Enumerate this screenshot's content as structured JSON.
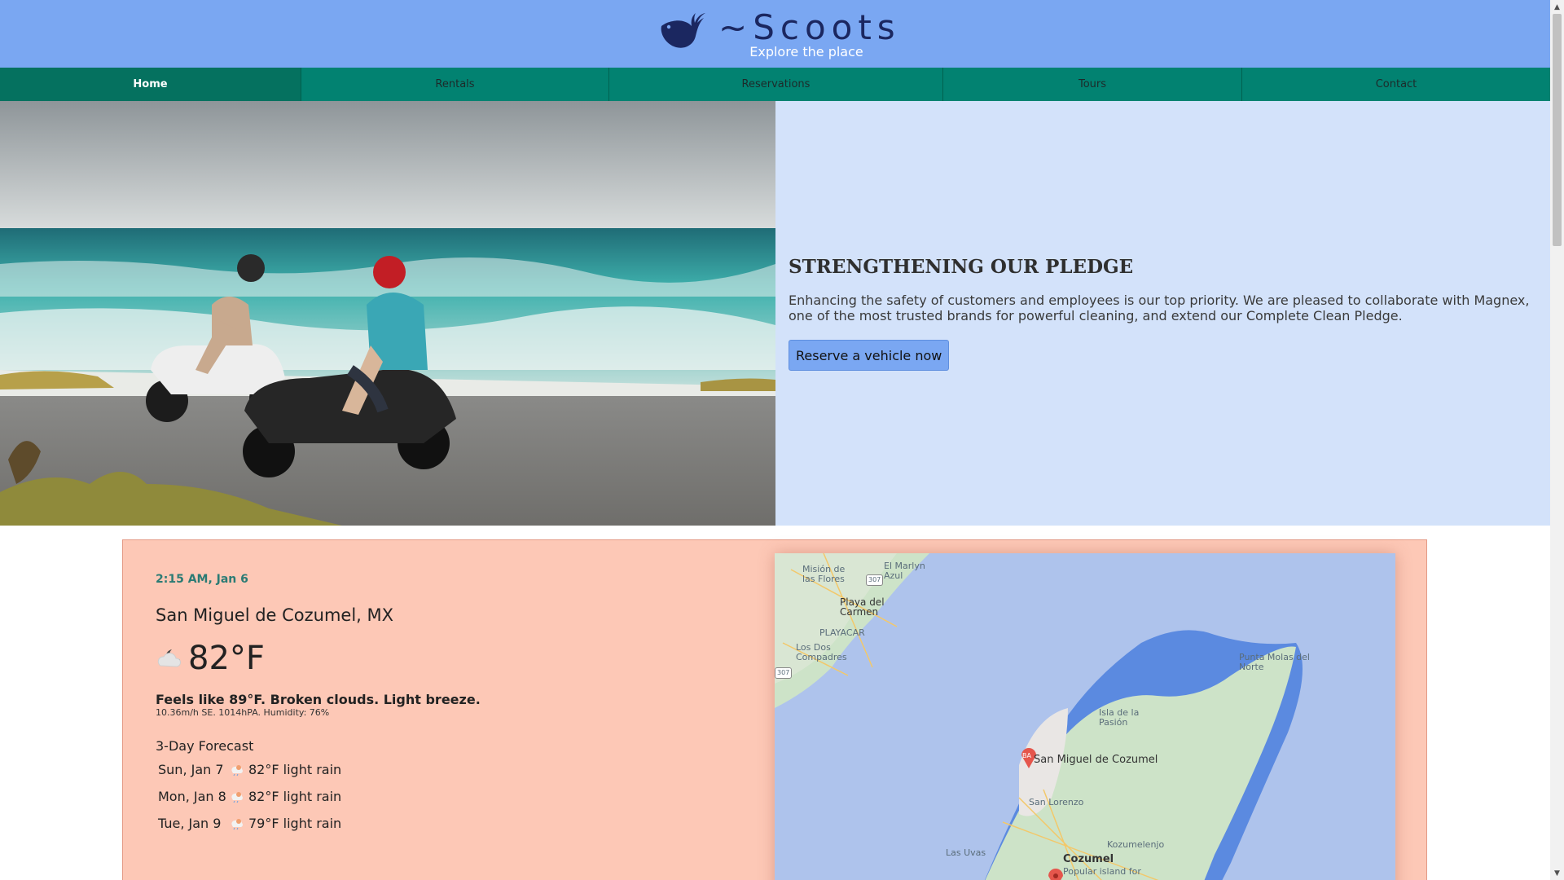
{
  "brand": {
    "name": "~Scoots",
    "tagline": "Explore the place",
    "color": "#1b2760"
  },
  "nav": {
    "items": [
      {
        "label": "Home",
        "active": true
      },
      {
        "label": "Rentals",
        "active": false
      },
      {
        "label": "Reservations",
        "active": false
      },
      {
        "label": "Tours",
        "active": false
      },
      {
        "label": "Contact",
        "active": false
      }
    ]
  },
  "hero": {
    "title": "STRENGTHENING OUR PLEDGE",
    "text": "Enhancing the safety of customers and employees is our top priority. We are pleased to collaborate with Magnex, one of the most trusted brands for powerful cleaning, and extend our Complete Clean Pledge.",
    "button_label": "Reserve a vehicle now",
    "photo_icon": "scooter-beach-photo"
  },
  "weather": {
    "time": "2:15 AM, Jan 6",
    "city": "San Miguel de Cozumel, MX",
    "temperature": "82°F",
    "icon": "cloudy-night-icon",
    "feels": "Feels like 89°F. Broken clouds. Light breeze.",
    "details": "10.36m/h SE. 1014hPA. Humidity: 76%",
    "forecast_title": "3-Day Forecast",
    "forecast": [
      {
        "day": "Sun, Jan 7",
        "desc": "82°F light rain",
        "icon": "rain-icon"
      },
      {
        "day": "Mon, Jan 8",
        "desc": "82°F light rain",
        "icon": "rain-icon"
      },
      {
        "day": "Tue, Jan 9",
        "desc": "79°F light rain",
        "icon": "rain-icon"
      }
    ]
  },
  "map": {
    "labels": {
      "mision": "Misión de las Flores",
      "marlyn": "El Marlyn Azul",
      "playa": "Playa del Carmen",
      "playacar": "PLAYACAR",
      "losdos": "Los Dos Compadres",
      "punta": "Punta Molas del Norte",
      "isla": "Isla de la Pasión",
      "sanmiguel": "San Miguel de Cozumel",
      "sanlorenzo": "San Lorenzo",
      "kozumelenjo": "Kozumelenjo",
      "lasuvas": "Las Uvas",
      "cozumel": "Cozumel",
      "cozumel_sub": "Popular island for",
      "route307a": "307",
      "route307b": "307"
    }
  }
}
